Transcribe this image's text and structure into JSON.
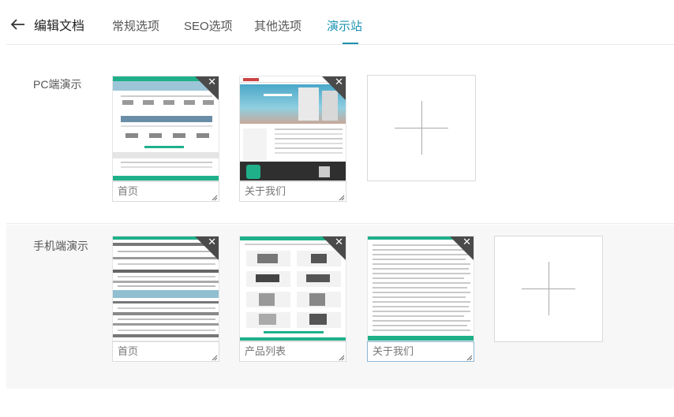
{
  "header": {
    "title": "编辑文档",
    "tabs": [
      {
        "label": "常规选项",
        "active": false
      },
      {
        "label": "SEO选项",
        "active": false
      },
      {
        "label": "其他选项",
        "active": false
      },
      {
        "label": "演示站",
        "active": true
      }
    ]
  },
  "pc": {
    "label": "PC端演示",
    "items": [
      {
        "name": "首页"
      },
      {
        "name": "关于我们"
      }
    ]
  },
  "mobile": {
    "label": "手机端演示",
    "items": [
      {
        "name": "首页"
      },
      {
        "name": "产品列表"
      },
      {
        "name": "关于我们"
      }
    ]
  },
  "colors": {
    "accent": "#1a92b0",
    "thumb_green": "#1fb08a",
    "close_corner": "#4a4a4a"
  },
  "icons": {
    "back": "arrow-left-icon",
    "close": "close-icon",
    "add": "plus-icon"
  }
}
